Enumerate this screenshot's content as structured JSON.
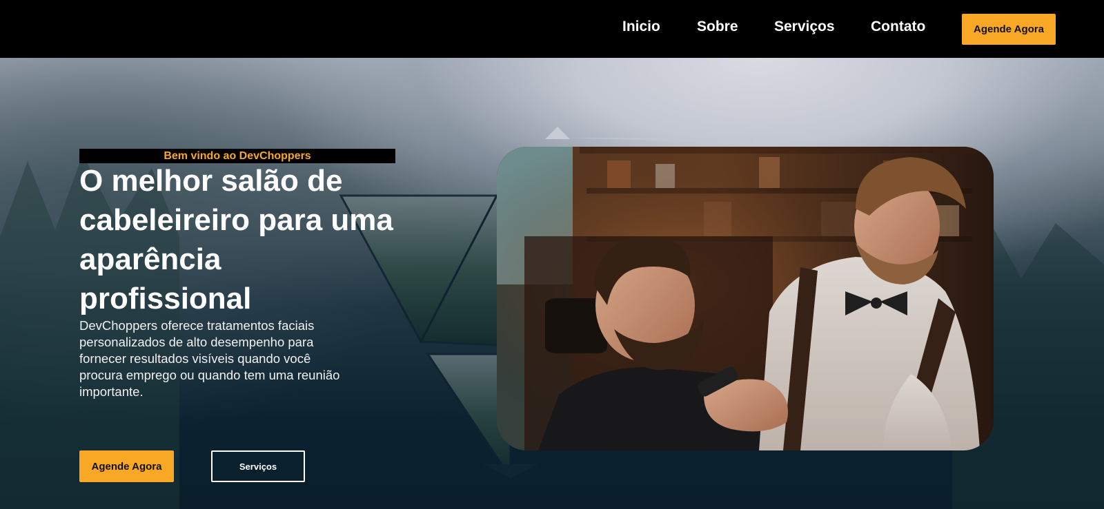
{
  "nav": {
    "links": [
      "Inicio",
      "Sobre",
      "Serviços",
      "Contato"
    ],
    "cta_label": "Agende Agora"
  },
  "hero": {
    "welcome": "Bem vindo ao DevChoppers",
    "headline": "O melhor salão de cabeleireiro para uma aparência profissional",
    "description": "DevChoppers oferece tratamentos faciais personalizados de alto desempenho para fornecer resultados visíveis quando você procura emprego ou quando tem uma reunião importante.",
    "primary_button": "Agende Agora",
    "secondary_button": "Serviços"
  },
  "colors": {
    "accent": "#f9a825",
    "navbar": "#000000",
    "text": "#ffffff"
  },
  "icons": []
}
